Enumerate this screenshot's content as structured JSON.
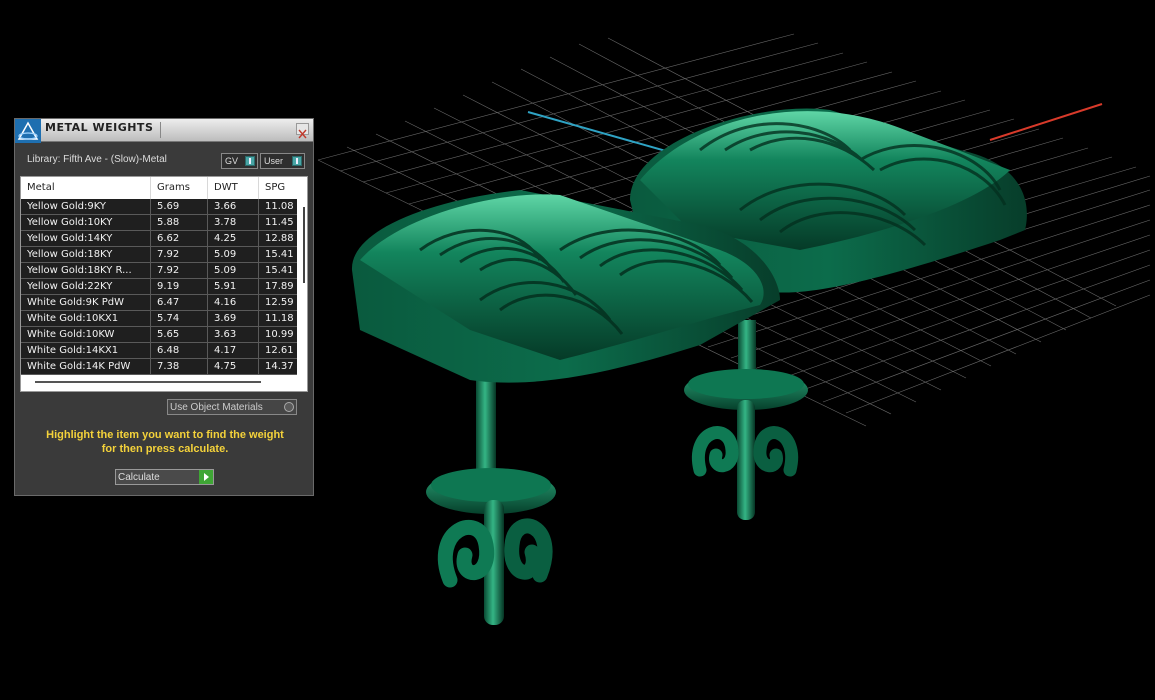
{
  "window": {
    "title": "METAL WEIGHTS",
    "library_label": "Library: Fifth Ave - (Slow)-Metal",
    "dropdown_gv": "GV",
    "dropdown_user": "User"
  },
  "table": {
    "headers": [
      "Metal",
      "Grams",
      "DWT",
      "SPG"
    ],
    "rows": [
      [
        "Yellow Gold:9KY",
        "5.69",
        "3.66",
        "11.08"
      ],
      [
        "Yellow Gold:10KY",
        "5.88",
        "3.78",
        "11.45"
      ],
      [
        "Yellow Gold:14KY",
        "6.62",
        "4.25",
        "12.88"
      ],
      [
        "Yellow Gold:18KY",
        "7.92",
        "5.09",
        "15.41"
      ],
      [
        "Yellow Gold:18KY R...",
        "7.92",
        "5.09",
        "15.41"
      ],
      [
        "Yellow Gold:22KY",
        "9.19",
        "5.91",
        "17.89"
      ],
      [
        "White Gold:9K PdW",
        "6.47",
        "4.16",
        "12.59"
      ],
      [
        "White Gold:10KX1",
        "5.74",
        "3.69",
        "11.18"
      ],
      [
        "White Gold:10KW",
        "5.65",
        "3.63",
        "10.99"
      ],
      [
        "White Gold:14KX1",
        "6.48",
        "4.17",
        "12.61"
      ],
      [
        "White Gold:14K PdW",
        "7.38",
        "4.75",
        "14.37"
      ]
    ]
  },
  "use_object_materials_label": "Use Object Materials",
  "help": {
    "line1": "Highlight the item you want to find the weight",
    "line2": "for then press calculate."
  },
  "calculate_label": "Calculate",
  "colors": {
    "model": "#0b6b4c",
    "grid": "#cfcfcf",
    "axis_x": "#d83a2a",
    "axis_y": "#2fa3c4",
    "help_text": "#f4d23a"
  }
}
